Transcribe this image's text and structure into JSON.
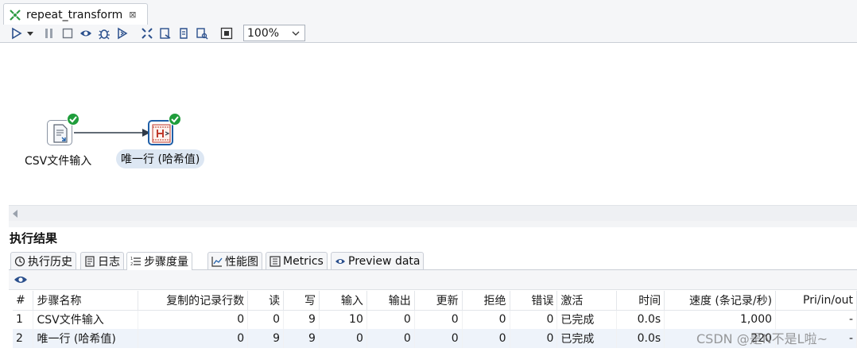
{
  "editor": {
    "tab_title": "repeat_transform",
    "tab_close": "⊠"
  },
  "toolbar": {
    "zoom": "100%"
  },
  "canvas": {
    "steps": [
      {
        "label": "CSV文件输入",
        "status": "ok"
      },
      {
        "label": "唯一行 (哈希值)",
        "status": "ok",
        "selected": true
      }
    ]
  },
  "results": {
    "title": "执行结果",
    "tabs": [
      {
        "label": "执行历史",
        "icon": "history-icon"
      },
      {
        "label": "日志",
        "icon": "log-icon"
      },
      {
        "label": "步骤度量",
        "icon": "step-metrics-icon",
        "active": true
      },
      {
        "label": "性能图",
        "icon": "performance-chart-icon"
      },
      {
        "label": "Metrics",
        "icon": "metrics-icon"
      },
      {
        "label": "Preview data",
        "icon": "preview-eye-icon"
      }
    ],
    "table": {
      "headers": [
        "#",
        "步骤名称",
        "复制的记录行数",
        "读",
        "写",
        "输入",
        "输出",
        "更新",
        "拒绝",
        "错误",
        "激活",
        "时间",
        "速度 (条记录/秒)",
        "Pri/in/out"
      ],
      "rows": [
        [
          "1",
          "CSV文件输入",
          "0",
          "0",
          "9",
          "10",
          "0",
          "0",
          "0",
          "0",
          "已完成",
          "0.0s",
          "1,000",
          "-"
        ],
        [
          "2",
          "唯一行 (哈希值)",
          "0",
          "9",
          "9",
          "0",
          "0",
          "0",
          "0",
          "0",
          "已完成",
          "0.0s",
          "220",
          "-"
        ]
      ]
    }
  },
  "watermark": "CSDN @是N不是L啦~",
  "colors": {
    "accent": "#1f5fa8",
    "success": "#1f9d3b",
    "selection": "#dde7f3"
  }
}
